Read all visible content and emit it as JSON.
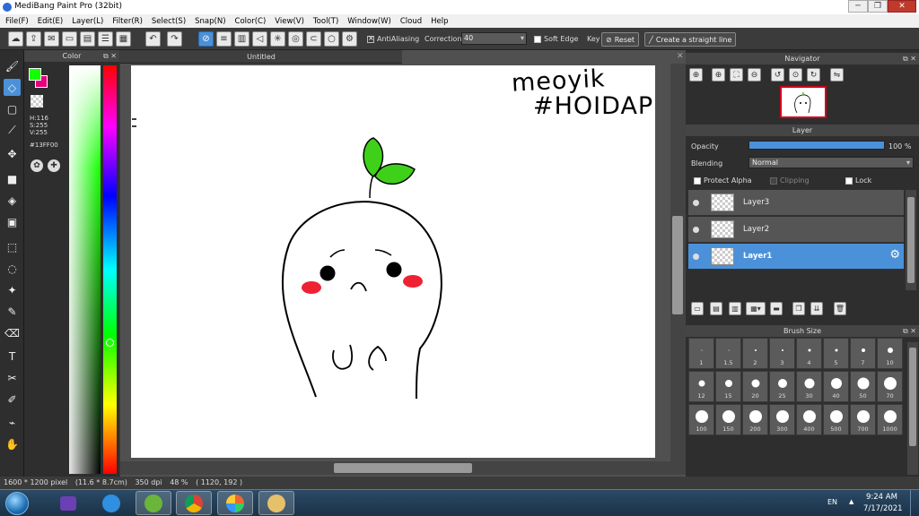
{
  "window": {
    "title": "MediBang Paint Pro (32bit)",
    "buttons": [
      "─",
      "❐",
      "✕"
    ]
  },
  "menu": [
    "File(F)",
    "Edit(E)",
    "Layer(L)",
    "Filter(R)",
    "Select(S)",
    "Snap(N)",
    "Color(C)",
    "View(V)",
    "Tool(T)",
    "Window(W)",
    "Cloud",
    "Help"
  ],
  "toolbar": {
    "antialiasing_label": "AntiAliasing",
    "antialiasing_checked": true,
    "correction_label": "Correction",
    "correction_value": "40",
    "soft_edge_label": "Soft Edge",
    "soft_edge_checked": false,
    "key_label": "Key",
    "reset_label": "Reset",
    "straight_line_label": "Create a straight line"
  },
  "color_panel": {
    "title": "Color",
    "foreground": "#13FF00",
    "background": "#E6007E",
    "h": "H:116",
    "s": "S:255",
    "v": "V:255",
    "hex": "#13FF00"
  },
  "document": {
    "tab_title": "Untitled",
    "handwriting_line1": "meoyik",
    "handwriting_line2": "#HOIDAP"
  },
  "navigator": {
    "title": "Navigator"
  },
  "layer_panel": {
    "title": "Layer",
    "opacity_label": "Opacity",
    "opacity_value": "100 %",
    "opacity_fraction": 1.0,
    "blending_label": "Blending",
    "blending_value": "Normal",
    "protect_alpha_label": "Protect Alpha",
    "clipping_label": "Clipping",
    "lock_label": "Lock",
    "layers": [
      {
        "name": "Layer3",
        "selected": false
      },
      {
        "name": "Layer2",
        "selected": false
      },
      {
        "name": "Layer1",
        "selected": true
      }
    ]
  },
  "brush_size": {
    "title": "Brush Size",
    "sizes": [
      "1",
      "1.5",
      "2",
      "3",
      "4",
      "5",
      "7",
      "10",
      "12",
      "15",
      "20",
      "25",
      "30",
      "40",
      "50",
      "70",
      "100",
      "150",
      "200",
      "300",
      "400",
      "500",
      "700",
      "1000"
    ]
  },
  "status": {
    "dimensions": "1600 * 1200 pixel",
    "physical": "(11.6 * 8.7cm)",
    "dpi": "350 dpi",
    "zoom": "48 %",
    "coords": "( 1120, 192 )"
  },
  "taskbar": {
    "lang": "EN",
    "time": "9:24 AM",
    "date": "7/17/2021"
  },
  "colors": {
    "accent": "#4b91d9",
    "panel": "#2e2e2e",
    "sprout": "#3fd11a",
    "blush": "#ee2233"
  }
}
